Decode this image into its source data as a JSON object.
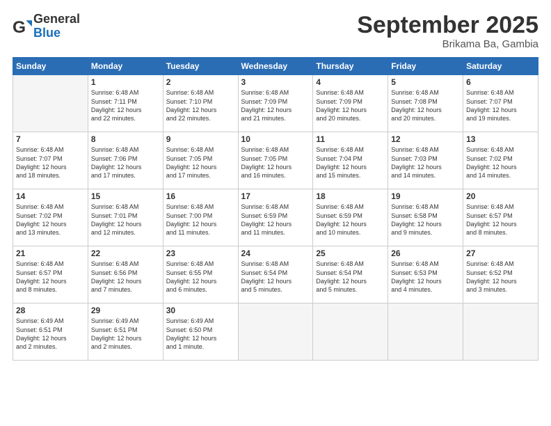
{
  "logo": {
    "general": "General",
    "blue": "Blue"
  },
  "title": "September 2025",
  "subtitle": "Brikama Ba, Gambia",
  "days_of_week": [
    "Sunday",
    "Monday",
    "Tuesday",
    "Wednesday",
    "Thursday",
    "Friday",
    "Saturday"
  ],
  "weeks": [
    [
      {
        "day": "",
        "info": ""
      },
      {
        "day": "1",
        "info": "Sunrise: 6:48 AM\nSunset: 7:11 PM\nDaylight: 12 hours\nand 22 minutes."
      },
      {
        "day": "2",
        "info": "Sunrise: 6:48 AM\nSunset: 7:10 PM\nDaylight: 12 hours\nand 22 minutes."
      },
      {
        "day": "3",
        "info": "Sunrise: 6:48 AM\nSunset: 7:09 PM\nDaylight: 12 hours\nand 21 minutes."
      },
      {
        "day": "4",
        "info": "Sunrise: 6:48 AM\nSunset: 7:09 PM\nDaylight: 12 hours\nand 20 minutes."
      },
      {
        "day": "5",
        "info": "Sunrise: 6:48 AM\nSunset: 7:08 PM\nDaylight: 12 hours\nand 20 minutes."
      },
      {
        "day": "6",
        "info": "Sunrise: 6:48 AM\nSunset: 7:07 PM\nDaylight: 12 hours\nand 19 minutes."
      }
    ],
    [
      {
        "day": "7",
        "info": "Sunrise: 6:48 AM\nSunset: 7:07 PM\nDaylight: 12 hours\nand 18 minutes."
      },
      {
        "day": "8",
        "info": "Sunrise: 6:48 AM\nSunset: 7:06 PM\nDaylight: 12 hours\nand 17 minutes."
      },
      {
        "day": "9",
        "info": "Sunrise: 6:48 AM\nSunset: 7:05 PM\nDaylight: 12 hours\nand 17 minutes."
      },
      {
        "day": "10",
        "info": "Sunrise: 6:48 AM\nSunset: 7:05 PM\nDaylight: 12 hours\nand 16 minutes."
      },
      {
        "day": "11",
        "info": "Sunrise: 6:48 AM\nSunset: 7:04 PM\nDaylight: 12 hours\nand 15 minutes."
      },
      {
        "day": "12",
        "info": "Sunrise: 6:48 AM\nSunset: 7:03 PM\nDaylight: 12 hours\nand 14 minutes."
      },
      {
        "day": "13",
        "info": "Sunrise: 6:48 AM\nSunset: 7:02 PM\nDaylight: 12 hours\nand 14 minutes."
      }
    ],
    [
      {
        "day": "14",
        "info": "Sunrise: 6:48 AM\nSunset: 7:02 PM\nDaylight: 12 hours\nand 13 minutes."
      },
      {
        "day": "15",
        "info": "Sunrise: 6:48 AM\nSunset: 7:01 PM\nDaylight: 12 hours\nand 12 minutes."
      },
      {
        "day": "16",
        "info": "Sunrise: 6:48 AM\nSunset: 7:00 PM\nDaylight: 12 hours\nand 11 minutes."
      },
      {
        "day": "17",
        "info": "Sunrise: 6:48 AM\nSunset: 6:59 PM\nDaylight: 12 hours\nand 11 minutes."
      },
      {
        "day": "18",
        "info": "Sunrise: 6:48 AM\nSunset: 6:59 PM\nDaylight: 12 hours\nand 10 minutes."
      },
      {
        "day": "19",
        "info": "Sunrise: 6:48 AM\nSunset: 6:58 PM\nDaylight: 12 hours\nand 9 minutes."
      },
      {
        "day": "20",
        "info": "Sunrise: 6:48 AM\nSunset: 6:57 PM\nDaylight: 12 hours\nand 8 minutes."
      }
    ],
    [
      {
        "day": "21",
        "info": "Sunrise: 6:48 AM\nSunset: 6:57 PM\nDaylight: 12 hours\nand 8 minutes."
      },
      {
        "day": "22",
        "info": "Sunrise: 6:48 AM\nSunset: 6:56 PM\nDaylight: 12 hours\nand 7 minutes."
      },
      {
        "day": "23",
        "info": "Sunrise: 6:48 AM\nSunset: 6:55 PM\nDaylight: 12 hours\nand 6 minutes."
      },
      {
        "day": "24",
        "info": "Sunrise: 6:48 AM\nSunset: 6:54 PM\nDaylight: 12 hours\nand 5 minutes."
      },
      {
        "day": "25",
        "info": "Sunrise: 6:48 AM\nSunset: 6:54 PM\nDaylight: 12 hours\nand 5 minutes."
      },
      {
        "day": "26",
        "info": "Sunrise: 6:48 AM\nSunset: 6:53 PM\nDaylight: 12 hours\nand 4 minutes."
      },
      {
        "day": "27",
        "info": "Sunrise: 6:48 AM\nSunset: 6:52 PM\nDaylight: 12 hours\nand 3 minutes."
      }
    ],
    [
      {
        "day": "28",
        "info": "Sunrise: 6:49 AM\nSunset: 6:51 PM\nDaylight: 12 hours\nand 2 minutes."
      },
      {
        "day": "29",
        "info": "Sunrise: 6:49 AM\nSunset: 6:51 PM\nDaylight: 12 hours\nand 2 minutes."
      },
      {
        "day": "30",
        "info": "Sunrise: 6:49 AM\nSunset: 6:50 PM\nDaylight: 12 hours\nand 1 minute."
      },
      {
        "day": "",
        "info": ""
      },
      {
        "day": "",
        "info": ""
      },
      {
        "day": "",
        "info": ""
      },
      {
        "day": "",
        "info": ""
      }
    ]
  ]
}
